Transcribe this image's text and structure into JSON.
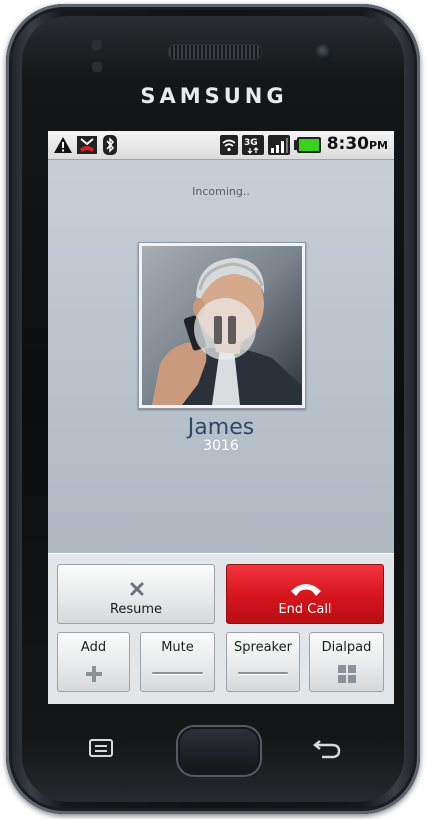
{
  "device": {
    "brand": "SAMSUNG"
  },
  "status_bar": {
    "time": "8:30",
    "ampm": "PM",
    "icons": [
      "warning-icon",
      "missed-call-icon",
      "bluetooth-icon",
      "wifi-icon",
      "3g-icon",
      "signal-icon",
      "battery-icon"
    ]
  },
  "call": {
    "status": "Incoming..",
    "caller_name": "James",
    "caller_number": "3016",
    "photo_overlay": "pause-icon"
  },
  "controls": {
    "resume_label": "Resume",
    "end_call_label": "End Call",
    "add_label": "Add",
    "mute_label": "Mute",
    "speaker_label": "Spreaker",
    "dialpad_label": "Dialpad"
  },
  "colors": {
    "end_call": "#d5141c",
    "caller_name": "#2e4a6b",
    "screen_bg": "#b6c0c9"
  }
}
